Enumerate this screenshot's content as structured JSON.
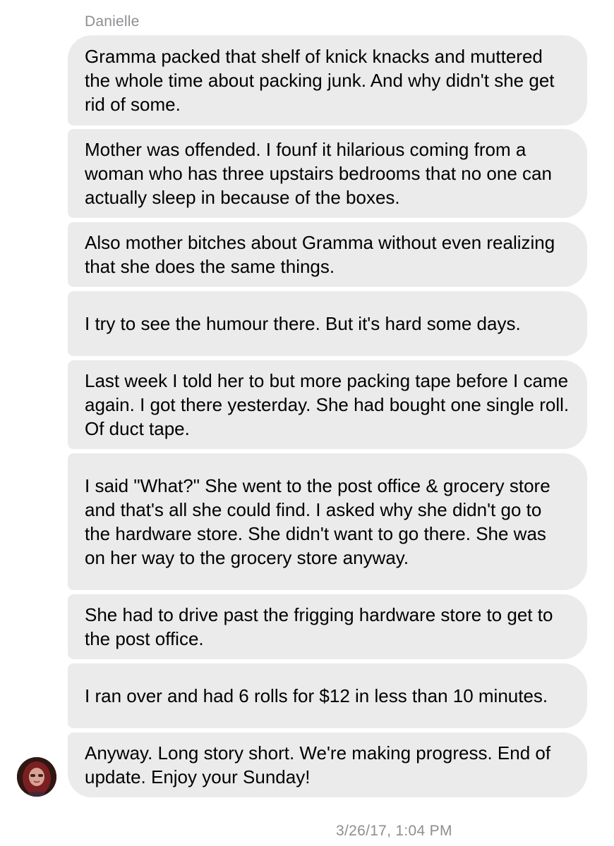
{
  "thread": {
    "sender_name": "Danielle",
    "avatar_icon": "user-avatar-photo",
    "messages": [
      "Gramma packed that shelf of knick knacks and muttered the whole time about packing junk. And why didn't she get rid of some.",
      "Mother was offended. I founf it hilarious coming from a woman who has three upstairs bedrooms that no one can actually sleep in because of the boxes.",
      "Also mother bitches about Gramma without even realizing that she does the same things.",
      "I try to see the humour there. But it's hard some days.",
      "Last week I told her to but more packing tape before I came again. I got there yesterday. She had bought one single roll. Of duct  tape.",
      "I said \"What?\" She went to the post office & grocery store and that's all she could find. I asked why she didn't go to the hardware store. She didn't want to go there. She was on her way to the grocery store anyway.",
      "She had to drive past the frigging hardware store to get to the post office.",
      "I ran over and had 6 rolls for $12 in less than 10 minutes.",
      "Anyway. Long story short. We're making progress. End of update. Enjoy your Sunday!"
    ],
    "timestamp": "3/26/17, 1:04 PM"
  },
  "colors": {
    "bubble_background": "#ebebeb",
    "meta_text": "#8e8e93",
    "message_text": "#000000"
  }
}
